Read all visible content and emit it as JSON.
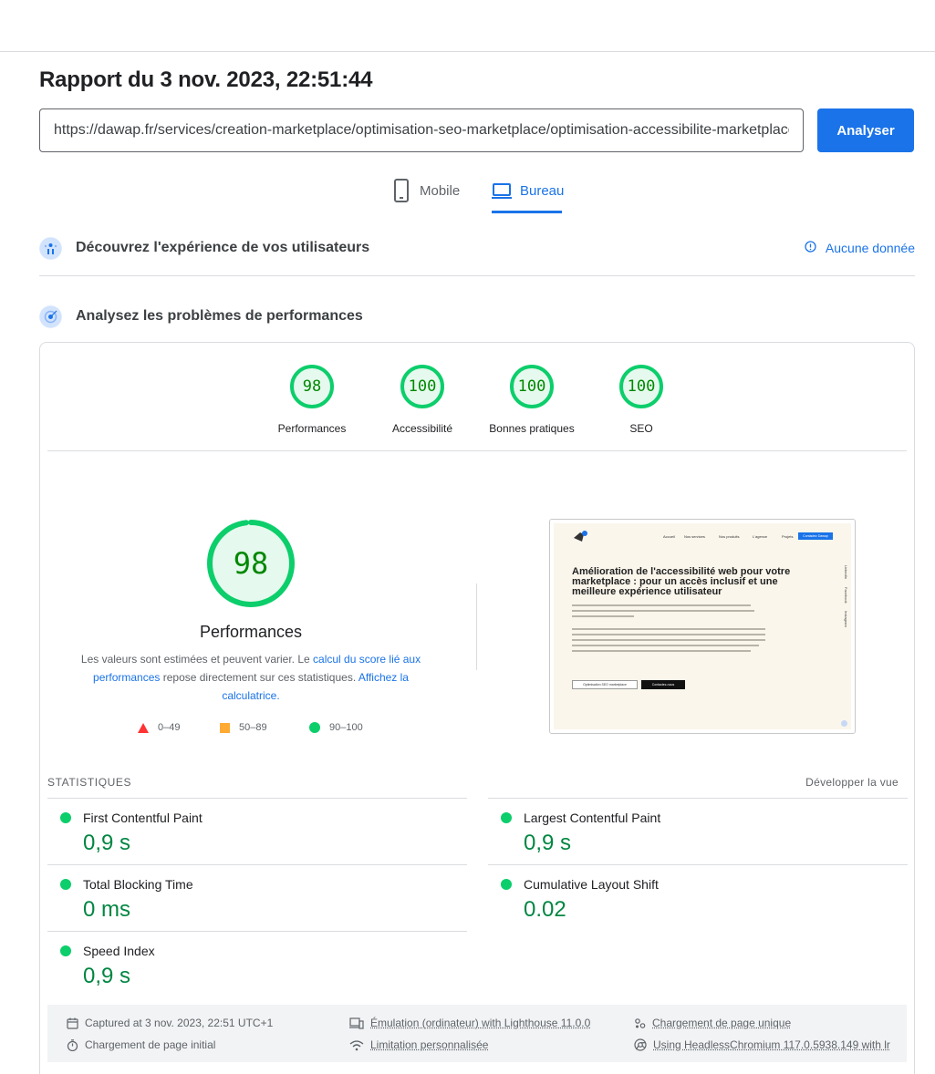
{
  "report": {
    "title": "Rapport du 3 nov. 2023, 22:51:44"
  },
  "search": {
    "url": "https://dawap.fr/services/creation-marketplace/optimisation-seo-marketplace/optimisation-accessibilite-marketplace/",
    "button_label": "Analyser"
  },
  "tabs": [
    {
      "label": "Mobile",
      "icon": "phone-icon",
      "active": false
    },
    {
      "label": "Bureau",
      "icon": "laptop-icon",
      "active": true
    }
  ],
  "experience": {
    "title": "Découvrez l'expérience de vos utilisateurs",
    "no_data": "Aucune donnée"
  },
  "diagnose": {
    "title": "Analysez les problèmes de performances"
  },
  "scores": [
    {
      "label": "Performances",
      "value": "98"
    },
    {
      "label": "Accessibilité",
      "value": "100"
    },
    {
      "label": "Bonnes pratiques",
      "value": "100"
    },
    {
      "label": "SEO",
      "value": "100"
    }
  ],
  "performance": {
    "score": "98",
    "score_fraction": 0.98,
    "heading": "Performances",
    "desc_1": "Les valeurs sont estimées et peuvent varier. Le ",
    "link_1": "calcul du score lié aux performances",
    "desc_2": " repose directement sur ces statistiques. ",
    "link_2": "Affichez la calculatrice."
  },
  "legend": [
    {
      "range": "0–49",
      "color": "#ff3333"
    },
    {
      "range": "50–89",
      "color": "#ffaa33"
    },
    {
      "range": "90–100",
      "color": "#0cce6b"
    }
  ],
  "preview": {
    "nav": [
      "Accueil",
      "Nos services",
      "Nos produits",
      "L'agence",
      "Projets"
    ],
    "cta": "Contactez Dawap",
    "headline": "Amélioration de l'accessibilité web pour votre marketplace : pour un accès inclusif et une meilleure expérience utilisateur",
    "btn1": "Optimisation SEO marketplace",
    "btn2": "Contactez-nous",
    "side": [
      "LinkedIn",
      "Facebook",
      "Instagram"
    ]
  },
  "stats": {
    "title": "STATISTIQUES",
    "expand": "Développer la vue",
    "metrics": [
      {
        "name": "First Contentful Paint",
        "value": "0,9 s"
      },
      {
        "name": "Largest Contentful Paint",
        "value": "0,9 s"
      },
      {
        "name": "Total Blocking Time",
        "value": "0 ms"
      },
      {
        "name": "Cumulative Layout Shift",
        "value": "0.02"
      },
      {
        "name": "Speed Index",
        "value": "0,9 s"
      }
    ]
  },
  "footer": {
    "captured": "Captured at 3 nov. 2023, 22:51 UTC+1",
    "emulation": "Émulation (ordinateur) with Lighthouse 11.0.0",
    "single_load": "Chargement de page unique",
    "initial_load": "Chargement de page initial",
    "throttling": "Limitation personnalisée",
    "browser": "Using HeadlessChromium 117.0.5938.149 with lr"
  }
}
